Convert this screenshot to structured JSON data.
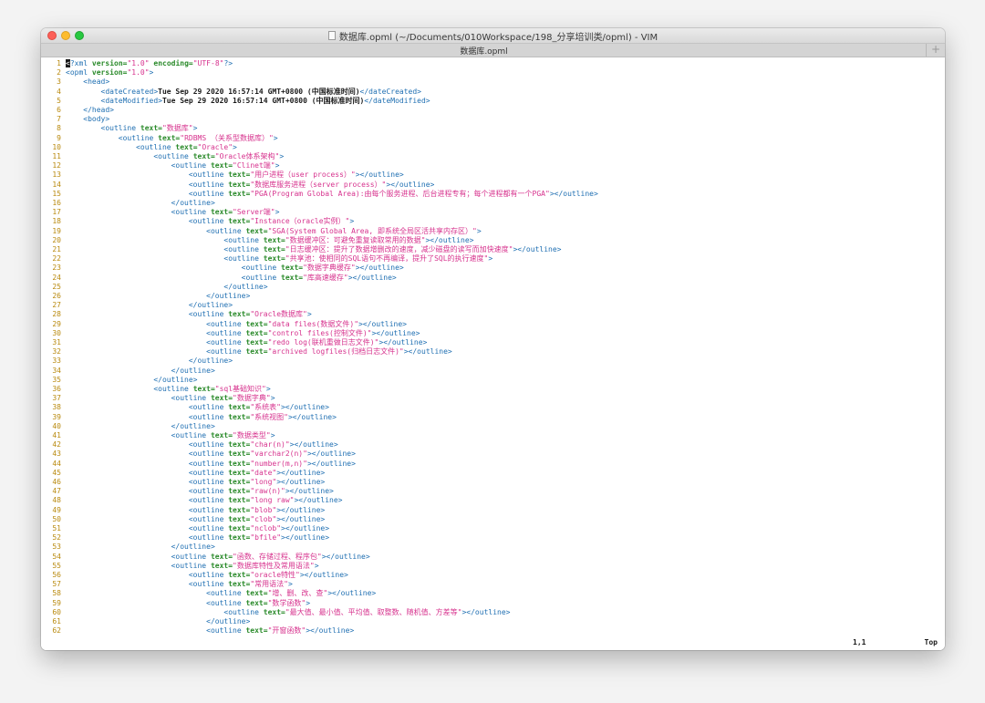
{
  "window": {
    "title": "数据库.opml (~/Documents/010Workspace/198_分享培训类/opml) - VIM",
    "tab_label": "数据库.opml",
    "new_tab_symbol": "+"
  },
  "status": {
    "position": "1,1",
    "scroll": "Top"
  },
  "lines": [
    {
      "n": 1,
      "indent": 0,
      "type": "xmldecl"
    },
    {
      "n": 2,
      "indent": 0,
      "type": "opml"
    },
    {
      "n": 3,
      "indent": 1,
      "type": "tag",
      "tag": "head"
    },
    {
      "n": 4,
      "indent": 2,
      "type": "elem",
      "tag": "dateCreated",
      "content": "Tue Sep 29 2020 16:57:14 GMT+0800 (中国标准时间)"
    },
    {
      "n": 5,
      "indent": 2,
      "type": "elem",
      "tag": "dateModified",
      "content": "Tue Sep 29 2020 16:57:14 GMT+0800 (中国标准时间)"
    },
    {
      "n": 6,
      "indent": 1,
      "type": "close",
      "tag": "head"
    },
    {
      "n": 7,
      "indent": 1,
      "type": "tag",
      "tag": "body"
    },
    {
      "n": 8,
      "indent": 2,
      "type": "open",
      "text": "数据库"
    },
    {
      "n": 9,
      "indent": 3,
      "type": "open",
      "text": "RDBMS （关系型数据库）"
    },
    {
      "n": 10,
      "indent": 4,
      "type": "open",
      "text": "Oracle"
    },
    {
      "n": 11,
      "indent": 5,
      "type": "open",
      "text": "Oracle体系架构"
    },
    {
      "n": 12,
      "indent": 6,
      "type": "open",
      "text": "Clinet端"
    },
    {
      "n": 13,
      "indent": 7,
      "type": "leaf",
      "text": "用户进程（user process）"
    },
    {
      "n": 14,
      "indent": 7,
      "type": "leaf",
      "text": "数据库服务进程（server process）"
    },
    {
      "n": 15,
      "indent": 7,
      "type": "leaf",
      "text": "PGA(Program Global Area):由每个服务进程、后台进程专有；每个进程都有一个PGA"
    },
    {
      "n": 16,
      "indent": 6,
      "type": "close",
      "tag": "outline"
    },
    {
      "n": 17,
      "indent": 6,
      "type": "open",
      "text": "Server端"
    },
    {
      "n": 18,
      "indent": 7,
      "type": "open",
      "text": "Instance（oracle实例）"
    },
    {
      "n": 19,
      "indent": 8,
      "type": "open",
      "text": "SGA(System Global Area, 即系统全局区活共享内存区）"
    },
    {
      "n": 20,
      "indent": 9,
      "type": "leaf",
      "text": "数据缓冲区：可避免重复读取常用的数据"
    },
    {
      "n": 21,
      "indent": 9,
      "type": "leaf",
      "text": "日志缓冲区：提升了数据增删改的速度，减少磁盘的读写而加快速度"
    },
    {
      "n": 22,
      "indent": 9,
      "type": "open",
      "text": "共享池：使相同的SQL语句不再编译，提升了SQL的执行速度"
    },
    {
      "n": 23,
      "indent": 10,
      "type": "leaf",
      "text": "数据字典缓存"
    },
    {
      "n": 24,
      "indent": 10,
      "type": "leaf",
      "text": "库高速缓存"
    },
    {
      "n": 25,
      "indent": 9,
      "type": "close",
      "tag": "outline"
    },
    {
      "n": 26,
      "indent": 8,
      "type": "close",
      "tag": "outline"
    },
    {
      "n": 27,
      "indent": 7,
      "type": "close",
      "tag": "outline"
    },
    {
      "n": 28,
      "indent": 7,
      "type": "open",
      "text": "Oracle数据库"
    },
    {
      "n": 29,
      "indent": 8,
      "type": "leaf",
      "text": "data files(数据文件)"
    },
    {
      "n": 30,
      "indent": 8,
      "type": "leaf",
      "text": "control files(控制文件)"
    },
    {
      "n": 31,
      "indent": 8,
      "type": "leaf",
      "text": "redo log(联机重做日志文件)"
    },
    {
      "n": 32,
      "indent": 8,
      "type": "leaf",
      "text": "archived logfiles(归档日志文件)"
    },
    {
      "n": 33,
      "indent": 7,
      "type": "close",
      "tag": "outline"
    },
    {
      "n": 34,
      "indent": 6,
      "type": "close",
      "tag": "outline"
    },
    {
      "n": 35,
      "indent": 5,
      "type": "close",
      "tag": "outline"
    },
    {
      "n": 36,
      "indent": 5,
      "type": "open",
      "text": "sql基础知识"
    },
    {
      "n": 37,
      "indent": 6,
      "type": "open",
      "text": "数据字典"
    },
    {
      "n": 38,
      "indent": 7,
      "type": "leaf",
      "text": "系统表"
    },
    {
      "n": 39,
      "indent": 7,
      "type": "leaf",
      "text": "系统视图"
    },
    {
      "n": 40,
      "indent": 6,
      "type": "close",
      "tag": "outline"
    },
    {
      "n": 41,
      "indent": 6,
      "type": "open",
      "text": "数据类型"
    },
    {
      "n": 42,
      "indent": 7,
      "type": "leaf",
      "text": "char(n)"
    },
    {
      "n": 43,
      "indent": 7,
      "type": "leaf",
      "text": "varchar2(n)"
    },
    {
      "n": 44,
      "indent": 7,
      "type": "leaf",
      "text": "number(m,n)"
    },
    {
      "n": 45,
      "indent": 7,
      "type": "leaf",
      "text": "date"
    },
    {
      "n": 46,
      "indent": 7,
      "type": "leaf",
      "text": "long"
    },
    {
      "n": 47,
      "indent": 7,
      "type": "leaf",
      "text": "raw(n)"
    },
    {
      "n": 48,
      "indent": 7,
      "type": "leaf",
      "text": "long raw"
    },
    {
      "n": 49,
      "indent": 7,
      "type": "leaf",
      "text": "blob"
    },
    {
      "n": 50,
      "indent": 7,
      "type": "leaf",
      "text": "clob"
    },
    {
      "n": 51,
      "indent": 7,
      "type": "leaf",
      "text": "nclob"
    },
    {
      "n": 52,
      "indent": 7,
      "type": "leaf",
      "text": "bfile"
    },
    {
      "n": 53,
      "indent": 6,
      "type": "close",
      "tag": "outline"
    },
    {
      "n": 54,
      "indent": 6,
      "type": "leaf",
      "text": "函数、存储过程、程序包"
    },
    {
      "n": 55,
      "indent": 6,
      "type": "open",
      "text": "数据库特性及常用语法"
    },
    {
      "n": 56,
      "indent": 7,
      "type": "leaf",
      "text": "oracle特性"
    },
    {
      "n": 57,
      "indent": 7,
      "type": "open",
      "text": "常用语法"
    },
    {
      "n": 58,
      "indent": 8,
      "type": "leaf",
      "text": "增、删、改、查"
    },
    {
      "n": 59,
      "indent": 8,
      "type": "open",
      "text": "数学函数"
    },
    {
      "n": 60,
      "indent": 9,
      "type": "leaf",
      "text": "最大值、最小值、平均值、取整数、随机值、方差等"
    },
    {
      "n": 61,
      "indent": 8,
      "type": "close",
      "tag": "outline"
    },
    {
      "n": 62,
      "indent": 8,
      "type": "leaf",
      "text": "开窗函数"
    }
  ]
}
